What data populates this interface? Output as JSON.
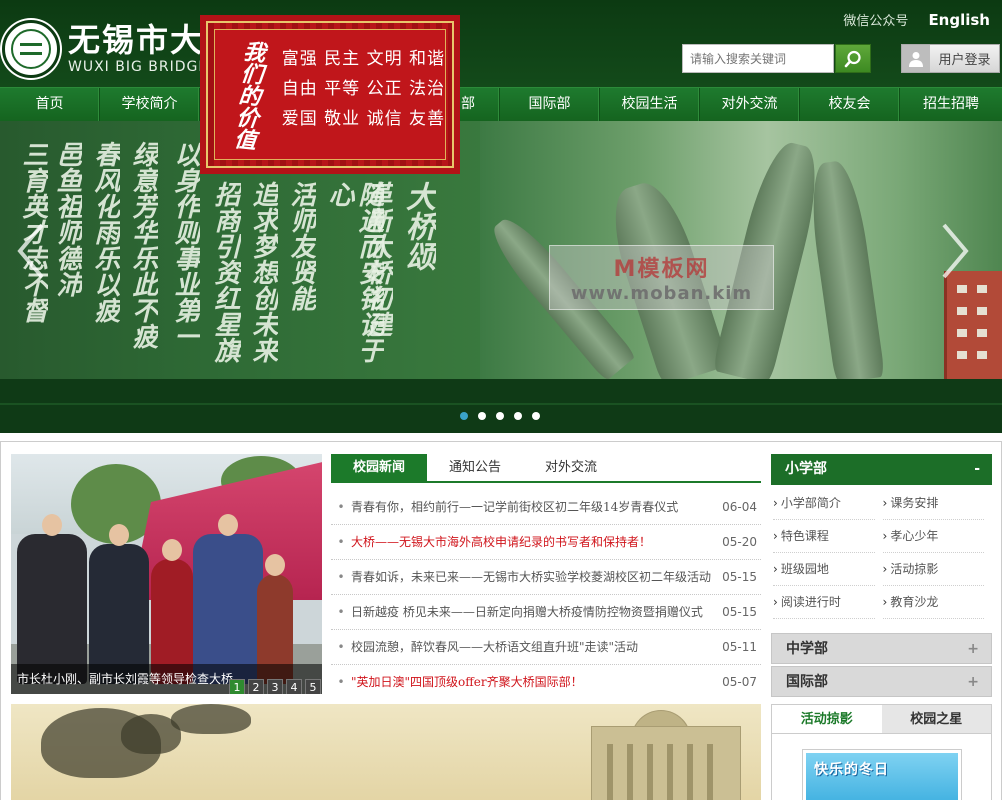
{
  "header": {
    "logo_cn": "无锡市大桥",
    "logo_en": "WUXI BIG BRIDGE",
    "wechat_label": "微信公众号",
    "english_label": "English",
    "search_placeholder": "请输入搜索关键词",
    "login_label": "用户登录"
  },
  "slogan": {
    "calligraphy": "我们的价值",
    "lines": [
      "富强 民主 文明 和谐",
      "自由 平等 公正 法治",
      "爱国 敬业 诚信 友善"
    ]
  },
  "nav": {
    "items": [
      {
        "label": "首页"
      },
      {
        "label": "学校简介"
      },
      {
        "label": ""
      },
      {
        "label": ""
      },
      {
        "label": "部"
      },
      {
        "label": "国际部"
      },
      {
        "label": "校园生活"
      },
      {
        "label": "对外交流"
      },
      {
        "label": "校友会"
      },
      {
        "label": "招生招聘"
      }
    ]
  },
  "banner": {
    "watermark_line1": "M模板网",
    "watermark_line2": "www.moban.kim",
    "calligraphy_cols": [
      "三育英才志不督",
      "邑鱼祖师德沛",
      "春风化雨乐以疲",
      "绿意芳华乐此不疲",
      "以身作则事业第一",
      "招商引资红星旗",
      "追求梦想创未来",
      "活师友贤能",
      "随遇而安铭记于心",
      "革新大桥初建",
      "大桥颂"
    ],
    "dots_count": 5,
    "active_dot": 0
  },
  "photo": {
    "caption": "市长杜小刚、副市长刘霞等领导检查大桥",
    "pages": [
      "1",
      "2",
      "3",
      "4",
      "5"
    ],
    "active_page": 0
  },
  "news": {
    "tabs": [
      {
        "label": "校园新闻",
        "active": true
      },
      {
        "label": "通知公告",
        "active": false
      },
      {
        "label": "对外交流",
        "active": false
      }
    ],
    "items": [
      {
        "title": "青春有你，相约前行—一记学前街校区初二年级14岁青春仪式",
        "date": "06-04",
        "red": false
      },
      {
        "title": "大桥——无锡大市海外高校申请纪录的书写者和保持者！",
        "date": "05-20",
        "red": true
      },
      {
        "title": "青春如诉，未来已来——无锡市大桥实验学校菱湖校区初二年级活动",
        "date": "05-15",
        "red": false
      },
      {
        "title": "日新越疫 桥见未来——日新定向捐赠大桥疫情防控物资暨捐赠仪式",
        "date": "05-15",
        "red": false
      },
      {
        "title": "校园流憩，醉饮春风——大桥语文组直升班\"走读\"活动",
        "date": "05-11",
        "red": false
      },
      {
        "title": "\"英加日澳\"四国顶级offer齐聚大桥国际部！",
        "date": "05-07",
        "red": true
      }
    ]
  },
  "side": {
    "primary_title": "小学部",
    "primary_toggle": "-",
    "links": [
      "小学部简介",
      "课务安排",
      "特色课程",
      "孝心少年",
      "班级园地",
      "活动掠影",
      "阅读进行时",
      "教育沙龙"
    ],
    "secondary": [
      {
        "title": "中学部",
        "toggle": "+"
      },
      {
        "title": "国际部",
        "toggle": "+"
      }
    ]
  },
  "activity": {
    "tabs": [
      "活动掠影",
      "校园之星"
    ],
    "thumb_text": "快乐的冬日"
  }
}
